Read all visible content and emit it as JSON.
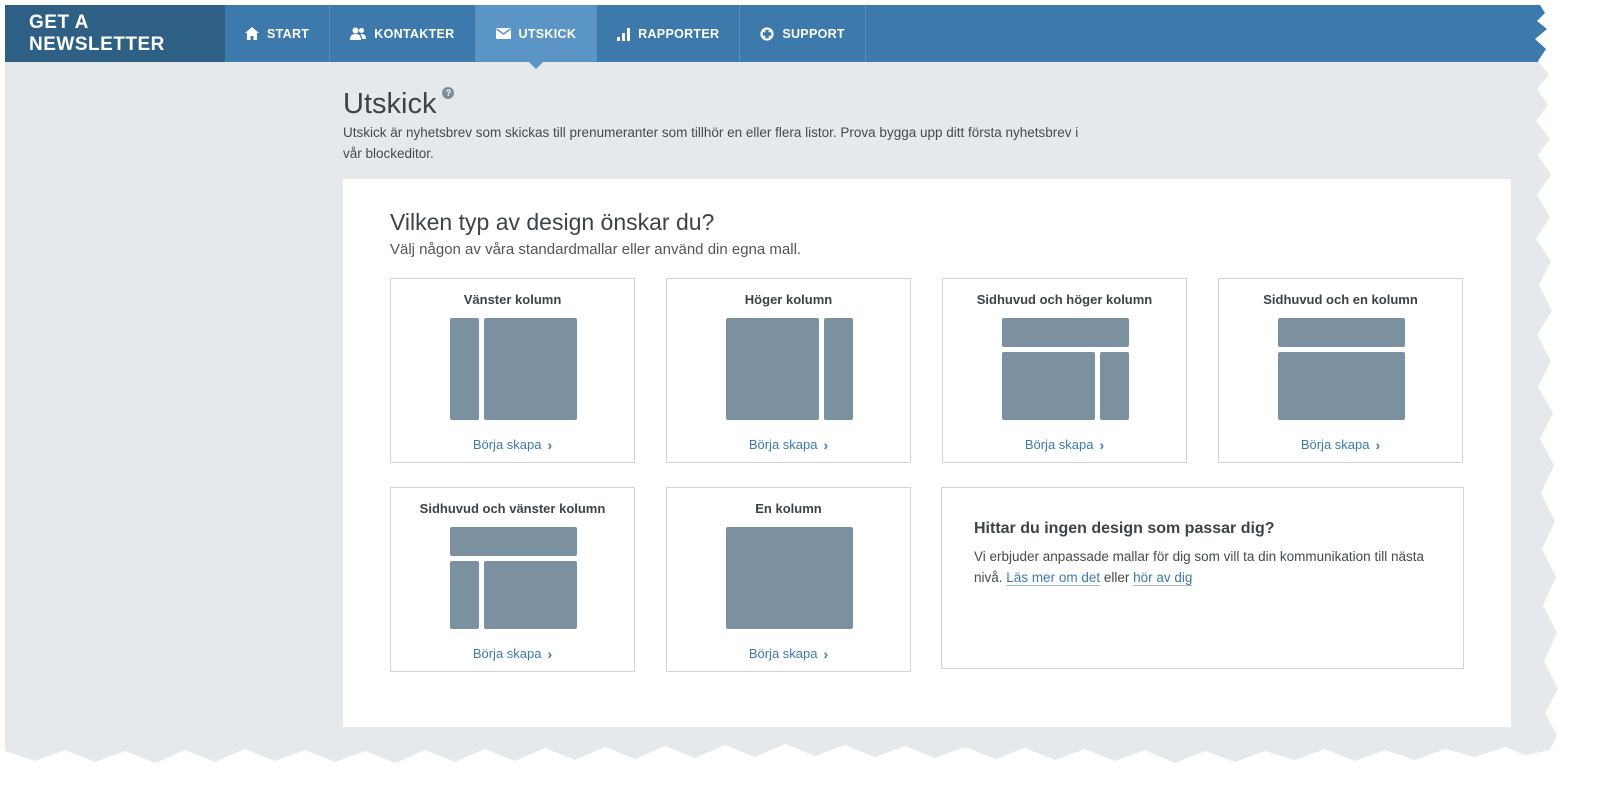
{
  "nav": {
    "brand": "GET A NEWSLETTER",
    "items": [
      {
        "label": "START",
        "icon": "home-icon"
      },
      {
        "label": "KONTAKTER",
        "icon": "contacts-icon"
      },
      {
        "label": "UTSKICK",
        "icon": "envelope-icon",
        "active": true
      },
      {
        "label": "RAPPORTER",
        "icon": "bar-chart-icon"
      },
      {
        "label": "SUPPORT",
        "icon": "lifebuoy-icon"
      }
    ]
  },
  "page": {
    "title": "Utskick",
    "help": "?",
    "description": "Utskick är nyhetsbrev som skickas till prenumeranter som tillhör en eller flera listor. Prova bygga upp ditt första nyhetsbrev i vår blockeditor."
  },
  "designs": {
    "heading": "Vilken typ av design önskar du?",
    "subheading": "Välj någon av våra standardmallar eller använd din egna mall.",
    "cta": "Börja skapa",
    "cards": [
      {
        "title": "Vänster kolumn",
        "layout": "left-column"
      },
      {
        "title": "Höger kolumn",
        "layout": "right-column"
      },
      {
        "title": "Sidhuvud och höger kolumn",
        "layout": "header-right-column"
      },
      {
        "title": "Sidhuvud och en kolumn",
        "layout": "header-one-column"
      },
      {
        "title": "Sidhuvud och vänster kolumn",
        "layout": "header-left-column"
      },
      {
        "title": "En kolumn",
        "layout": "one-column"
      }
    ]
  },
  "info": {
    "title": "Hittar du ingen design som passar dig?",
    "text_before": "Vi erbjuder anpassade mallar för dig som vill ta din kommunikation till nästa nivå.",
    "link1": "Läs mer om det",
    "between": "eller",
    "link2": "hör av dig"
  },
  "colors": {
    "nav_bg": "#3d7aab",
    "brand_bg": "#2e5f85",
    "active_tab": "#5a95c5",
    "page_bg": "#e6e9ec",
    "layout_block": "#7b919f",
    "link": "#3d7aab"
  }
}
